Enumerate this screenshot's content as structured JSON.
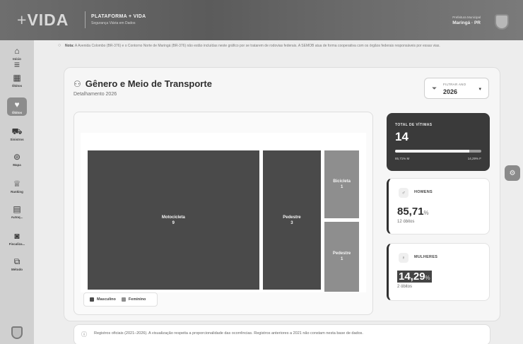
{
  "header": {
    "logo_plus": "+",
    "logo_text": "VIDA",
    "brand_title": "PLATAFORMA + VIDA",
    "brand_subtitle": "Segurança Viária em Dados",
    "pref_label": "Prefeitura Municipal",
    "pref_city": "Maringá · PR"
  },
  "sidebar": {
    "items": [
      {
        "label": "Início",
        "icon": "home-icon",
        "glyph": "⌂"
      },
      {
        "label": "Óbitos",
        "icon": "grid-icon",
        "glyph": "▦"
      },
      {
        "label": "Óbitos",
        "icon": "heart-pulse-icon",
        "glyph": "♥"
      },
      {
        "label": "Sinistros",
        "icon": "car-crash-icon",
        "glyph": "⛟"
      },
      {
        "label": "Mapa",
        "icon": "map-pin-icon",
        "glyph": "⊚"
      },
      {
        "label": "Ranking",
        "icon": "trophy-icon",
        "glyph": "♕"
      },
      {
        "label": "Autoq...",
        "icon": "document-icon",
        "glyph": "▤"
      },
      {
        "label": "Fiscaliza...",
        "icon": "camera-icon",
        "glyph": "◙"
      },
      {
        "label": "Método",
        "icon": "book-icon",
        "glyph": "⧉"
      }
    ]
  },
  "notice": {
    "bold": "Nota:",
    "text": "A Avenida Colombo (BR-376) e o Contorno Norte de Maringá (BR-376) não estão incluídas neste gráfico por se tratarem de rodovias federais. A SEMOB atua de forma cooperativa com os órgãos federais responsáveis por essas vias."
  },
  "card": {
    "title": "Gênero e Meio de Transporte",
    "subtitle": "Detalhamento 2026",
    "filter_label": "FILTRAR ANO",
    "filter_value": "2026"
  },
  "chart_data": {
    "type": "treemap",
    "groups": [
      {
        "name": "Masculino",
        "items": [
          {
            "label": "Motocicleta",
            "value": 9
          },
          {
            "label": "Pedestre",
            "value": 3
          }
        ]
      },
      {
        "name": "Feminino",
        "items": [
          {
            "label": "Bicicleta",
            "value": 1
          },
          {
            "label": "Pedestre",
            "value": 1
          }
        ]
      }
    ],
    "colors": {
      "Masculino": "#4a4a4a",
      "Feminino": "#8e8e8e"
    }
  },
  "legend": {
    "masculino": "Masculino",
    "feminino": "Feminino"
  },
  "stats": {
    "total_label": "TOTAL DE VÍTIMAS",
    "total_value": "14",
    "male_bar": "85,71% M",
    "female_bar": "14,29% F",
    "male_fraction": 0.8571,
    "men_label": "HOMENS",
    "men_value": "85,71",
    "men_pct": "%",
    "men_deaths": "12 óbitos",
    "women_label": "MULHERES",
    "women_value": "14,29",
    "women_pct": "%",
    "women_deaths": "2 óbitos"
  },
  "info": {
    "text": "Registros oficiais (2021–2026). A visualização respeita a proporcionalidade das ocorrências. Registros anteriores a 2021 não constam nesta base de dados."
  }
}
